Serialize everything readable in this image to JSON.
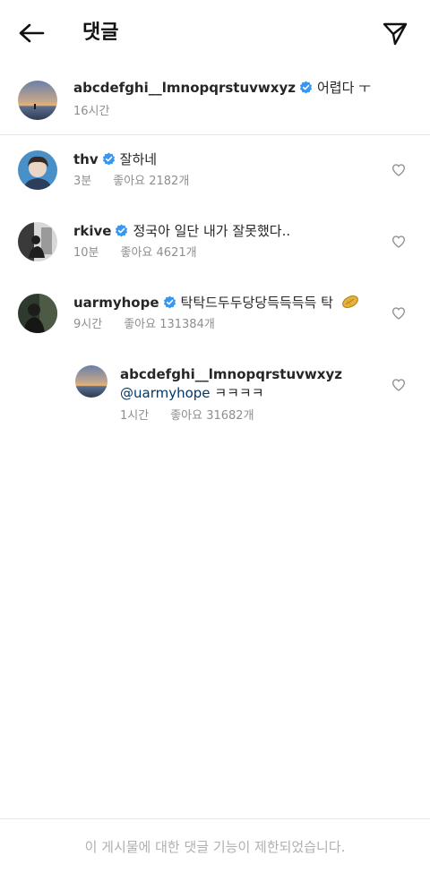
{
  "header": {
    "title": "댓글",
    "back_icon": "arrow-left-icon",
    "share_icon": "paper-plane-icon"
  },
  "caption": {
    "username": "abcdefghi__lmnopqrstuvwxyz",
    "text": "어렵다 ㅜ",
    "time": "16시간"
  },
  "comments": [
    {
      "username": "thv",
      "text": "잘하네",
      "time": "3분",
      "likes": "좋아요 2182개"
    },
    {
      "username": "rkive",
      "text": "정국아 일단 내가 잘못했다..",
      "time": "10분",
      "likes": "좋아요 4621개"
    },
    {
      "username": "uarmyhope",
      "text": "탁탁드두두당당득득득득 탁",
      "time": "9시간",
      "likes": "좋아요 131384개"
    }
  ],
  "reply": {
    "username": "abcdefghi__lmnopqrstuvwxyz",
    "mention": "@uarmyhope",
    "text": "ㅋㅋㅋㅋ",
    "time": "1시간",
    "likes": "좋아요 31682개"
  },
  "footer": {
    "text": "이 게시물에 대한 댓글 기능이 제한되었습니다."
  },
  "colors": {
    "verified_blue": "#3897f0",
    "meta_gray": "#8e8e8e",
    "mention_blue": "#00376b"
  }
}
